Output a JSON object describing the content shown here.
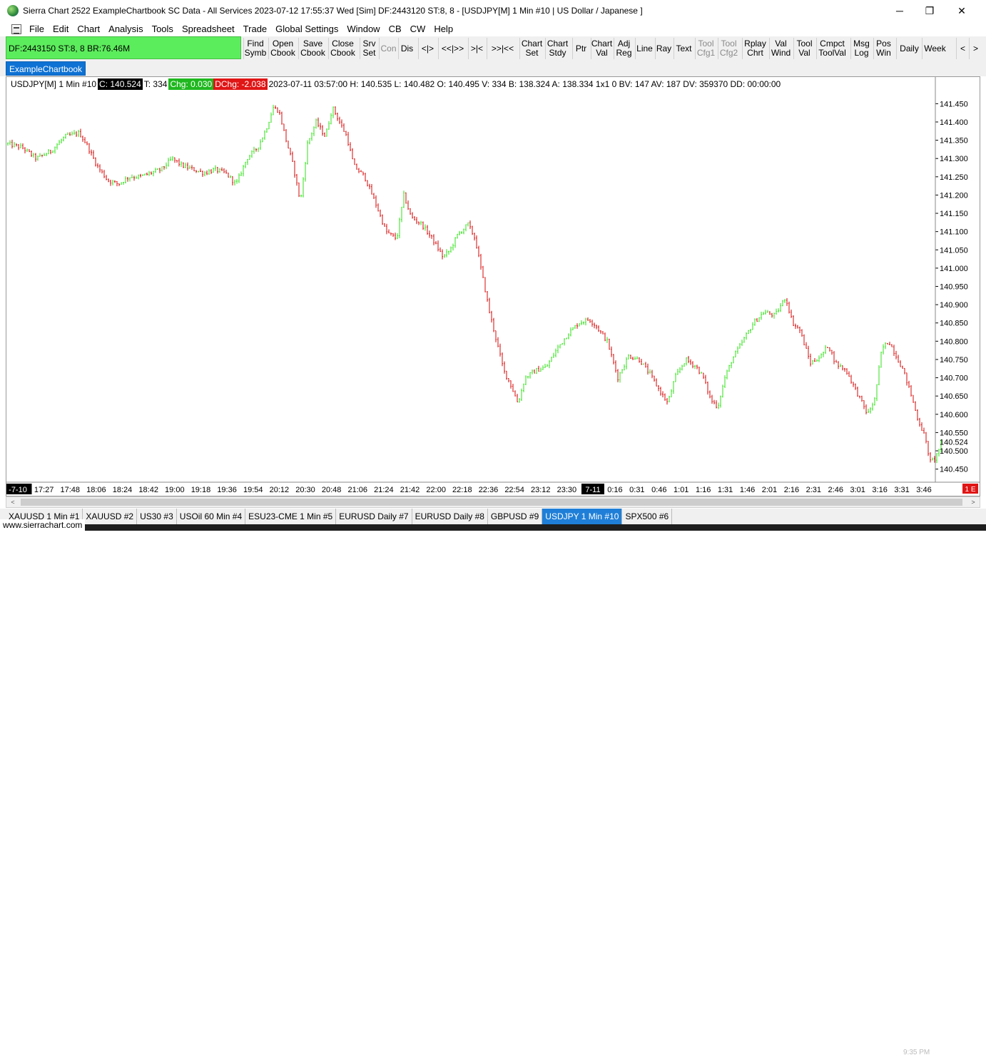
{
  "window": {
    "title": "Sierra Chart 2522 ExampleChartbook SC Data - All Services 2023-07-12  17:55:37 Wed [Sim]  DF:2443120  ST:8, 8 - [USDJPY[M]  1 Min  #10 | US Dollar / Japanese ]",
    "controls": [
      "─",
      "❐",
      "✕"
    ]
  },
  "menu": [
    "File",
    "Edit",
    "Chart",
    "Analysis",
    "Tools",
    "Spreadsheet",
    "Trade",
    "Global Settings",
    "Window",
    "CB",
    "CW",
    "Help"
  ],
  "mdi_controls": [
    "–",
    "❐",
    "✕"
  ],
  "status_box": "DF:2443150  ST:8, 8  BR:76.46M",
  "toolbar": [
    {
      "label": "Find\nSymb",
      "enabled": true
    },
    {
      "label": "Open\nCbook",
      "enabled": true
    },
    {
      "label": "Save\nCbook",
      "enabled": true
    },
    {
      "label": "Close\nCbook",
      "enabled": true
    },
    {
      "label": "Srv\nSet",
      "enabled": true
    },
    {
      "label": "Con",
      "enabled": false
    },
    {
      "label": "Dis",
      "enabled": true
    },
    {
      "label": "<|>",
      "enabled": true
    },
    {
      "label": "<<|>>",
      "enabled": true
    },
    {
      "label": ">|<",
      "enabled": true
    },
    {
      "label": ">>|<<",
      "enabled": true
    },
    {
      "label": "Chart\nSet",
      "enabled": true
    },
    {
      "label": "Chart\nStdy",
      "enabled": true
    },
    {
      "label": "Ptr",
      "enabled": true
    },
    {
      "label": "Chart\nVal",
      "enabled": true
    },
    {
      "label": "Adj\nReg",
      "enabled": true
    },
    {
      "label": "Line",
      "enabled": true
    },
    {
      "label": "Ray",
      "enabled": true
    },
    {
      "label": "Text",
      "enabled": true
    },
    {
      "label": "Tool\nCfg1",
      "enabled": false
    },
    {
      "label": "Tool\nCfg2",
      "enabled": false
    },
    {
      "label": "Rplay\nChrt",
      "enabled": true
    },
    {
      "label": "Val\nWind",
      "enabled": true
    },
    {
      "label": "Tool\nVal",
      "enabled": true
    },
    {
      "label": "Cmpct\nToolVal",
      "enabled": true
    },
    {
      "label": "Msg\nLog",
      "enabled": true
    },
    {
      "label": "Pos\nWin",
      "enabled": true
    },
    {
      "label": "Daily",
      "enabled": true
    },
    {
      "label": "Week",
      "enabled": true
    },
    {
      "label": "<",
      "enabled": true
    },
    {
      "label": ">",
      "enabled": true
    }
  ],
  "chartbook_tab": "ExampleChartbook",
  "info": {
    "symbol": "USDJPY[M]  1 Min  #10",
    "close": "C: 140.524",
    "trades": "T: 334",
    "chg": "Chg: 0.030",
    "dchg": "DChg: -2.038",
    "details": "2023-07-11 03:57:00 H: 140.535 L: 140.482 O: 140.495 V: 334 B: 138.324 A: 138.334 1x1 0 BV: 147 AV: 187 DV: 359370 DD: 00:00:00"
  },
  "chart_data": {
    "type": "ohlc-bar",
    "symbol": "USDJPY[M]",
    "interval": "1 Min",
    "y_ticks": [
      "141.450",
      "141.400",
      "141.350",
      "141.300",
      "141.250",
      "141.200",
      "141.150",
      "141.100",
      "141.050",
      "141.000",
      "140.950",
      "140.900",
      "140.850",
      "140.800",
      "140.750",
      "140.700",
      "140.650",
      "140.600",
      "140.550",
      "140.500",
      "140.450"
    ],
    "ylim": [
      140.42,
      141.48
    ],
    "last_price_label": "140.524",
    "last_price": 140.524,
    "x_ticks": [
      "-7-10",
      "17:27",
      "17:48",
      "18:06",
      "18:24",
      "18:42",
      "19:00",
      "19:18",
      "19:36",
      "19:54",
      "20:12",
      "20:30",
      "20:48",
      "21:06",
      "21:24",
      "21:42",
      "22:00",
      "22:18",
      "22:36",
      "22:54",
      "23:12",
      "23:30",
      "7-11",
      "0:16",
      "0:31",
      "0:46",
      "1:01",
      "1:16",
      "1:31",
      "1:46",
      "2:01",
      "2:16",
      "2:31",
      "2:46",
      "3:01",
      "3:16",
      "3:31",
      "3:46"
    ],
    "x_highlight": [
      "-7-10",
      "7-11"
    ],
    "corner_marker": "1 E",
    "up_color": "#32e01a",
    "down_color": "#d40a0a",
    "close_path": [
      [
        0,
        141.34
      ],
      [
        20,
        141.33
      ],
      [
        40,
        141.3
      ],
      [
        60,
        141.32
      ],
      [
        80,
        141.36
      ],
      [
        100,
        141.37
      ],
      [
        110,
        141.34
      ],
      [
        125,
        141.28
      ],
      [
        140,
        141.24
      ],
      [
        155,
        141.23
      ],
      [
        170,
        141.25
      ],
      [
        185,
        141.25
      ],
      [
        200,
        141.26
      ],
      [
        215,
        141.27
      ],
      [
        230,
        141.3
      ],
      [
        245,
        141.28
      ],
      [
        260,
        141.27
      ],
      [
        275,
        141.26
      ],
      [
        290,
        141.27
      ],
      [
        305,
        141.26
      ],
      [
        320,
        141.23
      ],
      [
        335,
        141.3
      ],
      [
        350,
        141.33
      ],
      [
        362,
        141.38
      ],
      [
        372,
        141.44
      ],
      [
        380,
        141.43
      ],
      [
        390,
        141.35
      ],
      [
        400,
        141.28
      ],
      [
        410,
        141.18
      ],
      [
        420,
        141.34
      ],
      [
        432,
        141.4
      ],
      [
        445,
        141.36
      ],
      [
        455,
        141.44
      ],
      [
        465,
        141.4
      ],
      [
        475,
        141.36
      ],
      [
        485,
        141.28
      ],
      [
        500,
        141.25
      ],
      [
        515,
        141.18
      ],
      [
        530,
        141.1
      ],
      [
        545,
        141.08
      ],
      [
        555,
        141.2
      ],
      [
        565,
        141.14
      ],
      [
        580,
        141.12
      ],
      [
        595,
        141.08
      ],
      [
        610,
        141.03
      ],
      [
        620,
        141.05
      ],
      [
        630,
        141.09
      ],
      [
        645,
        141.12
      ],
      [
        655,
        141.08
      ],
      [
        665,
        140.98
      ],
      [
        675,
        140.88
      ],
      [
        685,
        140.8
      ],
      [
        695,
        140.72
      ],
      [
        705,
        140.68
      ],
      [
        715,
        140.63
      ],
      [
        725,
        140.7
      ],
      [
        740,
        140.72
      ],
      [
        755,
        140.73
      ],
      [
        770,
        140.78
      ],
      [
        785,
        140.82
      ],
      [
        800,
        140.85
      ],
      [
        815,
        140.86
      ],
      [
        825,
        140.84
      ],
      [
        840,
        140.8
      ],
      [
        855,
        140.7
      ],
      [
        870,
        140.76
      ],
      [
        885,
        140.75
      ],
      [
        900,
        140.71
      ],
      [
        915,
        140.66
      ],
      [
        925,
        140.63
      ],
      [
        935,
        140.7
      ],
      [
        950,
        140.75
      ],
      [
        965,
        140.73
      ],
      [
        975,
        140.7
      ],
      [
        985,
        140.64
      ],
      [
        995,
        140.62
      ],
      [
        1005,
        140.7
      ],
      [
        1015,
        140.75
      ],
      [
        1030,
        140.8
      ],
      [
        1045,
        140.85
      ],
      [
        1060,
        140.88
      ],
      [
        1075,
        140.87
      ],
      [
        1090,
        140.92
      ],
      [
        1100,
        140.85
      ],
      [
        1110,
        140.83
      ],
      [
        1125,
        140.74
      ],
      [
        1140,
        140.76
      ],
      [
        1150,
        140.79
      ],
      [
        1160,
        140.74
      ],
      [
        1175,
        140.72
      ],
      [
        1190,
        140.66
      ],
      [
        1205,
        140.6
      ],
      [
        1215,
        140.64
      ],
      [
        1225,
        140.78
      ],
      [
        1235,
        140.8
      ],
      [
        1245,
        140.76
      ],
      [
        1255,
        140.72
      ],
      [
        1265,
        140.66
      ],
      [
        1275,
        140.59
      ],
      [
        1285,
        140.54
      ],
      [
        1293,
        140.47
      ],
      [
        1300,
        140.48
      ],
      [
        1308,
        140.52
      ]
    ]
  },
  "scrollbar": {
    "left": "<",
    "right": ">"
  },
  "chart_tabs": [
    {
      "label": "XAUUSD  1 Min  #1",
      "active": false
    },
    {
      "label": "XAUUSD #2",
      "active": false
    },
    {
      "label": "US30 #3",
      "active": false
    },
    {
      "label": "USOil  60 Min  #4",
      "active": false
    },
    {
      "label": "ESU23-CME  1 Min  #5",
      "active": false
    },
    {
      "label": "EURUSD  Daily #7",
      "active": false
    },
    {
      "label": "EURUSD  Daily #8",
      "active": false
    },
    {
      "label": "GBPUSD #9",
      "active": false
    },
    {
      "label": "USDJPY  1 Min  #10",
      "active": true
    },
    {
      "label": "SPX500 #6",
      "active": false
    }
  ],
  "site_label": "www.sierrachart.com",
  "clock_label": "9:35 PM"
}
